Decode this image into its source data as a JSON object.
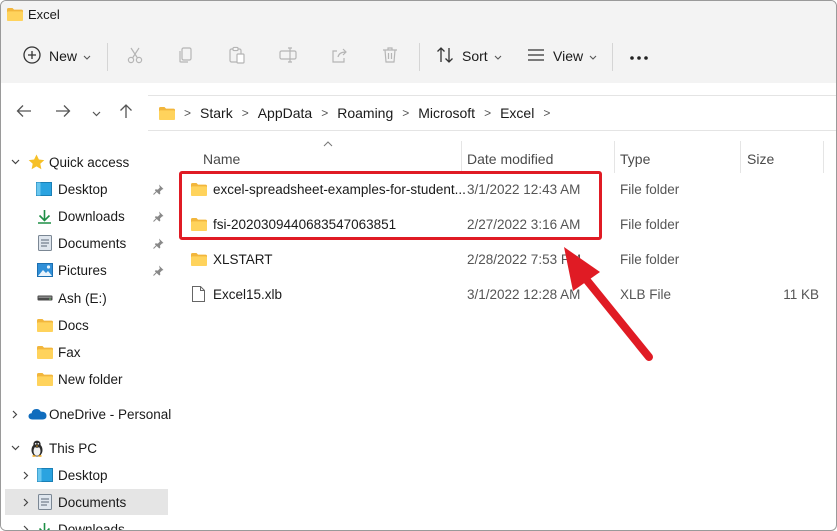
{
  "window": {
    "title": "Excel"
  },
  "toolbar": {
    "new_label": "New",
    "sort_label": "Sort",
    "view_label": "View",
    "icons": [
      "plus-circle-icon",
      "cut-icon",
      "copy-icon",
      "paste-icon",
      "rename-icon",
      "share-icon",
      "delete-icon",
      "sort-icon",
      "view-icon",
      "more-icon"
    ]
  },
  "address": {
    "crumbs": [
      "Stark",
      "AppData",
      "Roaming",
      "Microsoft",
      "Excel"
    ]
  },
  "sidebar": {
    "quick_access": "Quick access",
    "items": [
      {
        "label": "Desktop",
        "icon": "desktop-icon",
        "pinned": true
      },
      {
        "label": "Downloads",
        "icon": "download-icon",
        "pinned": true
      },
      {
        "label": "Documents",
        "icon": "documents-icon",
        "pinned": true
      },
      {
        "label": "Pictures",
        "icon": "pictures-icon",
        "pinned": true
      },
      {
        "label": "Ash (E:)",
        "icon": "drive-icon",
        "pinned": false
      },
      {
        "label": "Docs",
        "icon": "folder-icon",
        "pinned": false
      },
      {
        "label": "Fax",
        "icon": "folder-icon",
        "pinned": false
      },
      {
        "label": "New folder",
        "icon": "folder-icon",
        "pinned": false
      }
    ],
    "onedrive": "OneDrive - Personal",
    "this_pc": "This PC",
    "pc_items": [
      {
        "label": "Desktop",
        "icon": "desktop-icon"
      },
      {
        "label": "Documents",
        "icon": "documents-icon",
        "selected": true
      },
      {
        "label": "Downloads",
        "icon": "download-icon"
      }
    ]
  },
  "columns": {
    "name": "Name",
    "date": "Date modified",
    "type": "Type",
    "size": "Size"
  },
  "files": [
    {
      "name": "excel-spreadsheet-examples-for-student...",
      "date": "3/1/2022 12:43 AM",
      "type": "File folder",
      "size": "",
      "icon": "folder-icon"
    },
    {
      "name": "fsi-2020309440683547063851",
      "date": "2/27/2022 3:16 AM",
      "type": "File folder",
      "size": "",
      "icon": "folder-icon"
    },
    {
      "name": "XLSTART",
      "date": "2/28/2022 7:53 PM",
      "type": "File folder",
      "size": "",
      "icon": "folder-icon"
    },
    {
      "name": "Excel15.xlb",
      "date": "3/1/2022 12:28 AM",
      "type": "XLB File",
      "size": "11 KB",
      "icon": "file-icon"
    }
  ],
  "annotation": {
    "highlight_color": "#e01b24",
    "arrow_color": "#e01b24"
  },
  "colors": {
    "folder": "#f5c242",
    "accent": "#0067c0"
  }
}
